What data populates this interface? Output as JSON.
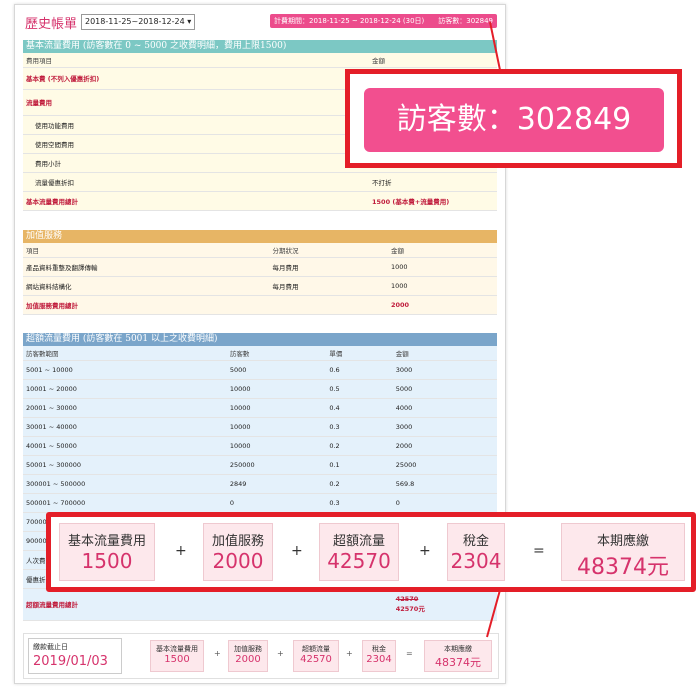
{
  "header": {
    "title": "歷史帳單",
    "period_select": "2018-11-25~2018-12-24",
    "summary_chip": "計費期間：2018-11-25 ~ 2018-12-24 (30日)　　訪客數：302849"
  },
  "basic": {
    "title": "基本流量費用 (訪客數在 0 ~ 5000 之收費明細，費用上限1500)",
    "col_item": "費用項目",
    "col_amount": "金額",
    "rows": [
      {
        "item": "基本費 (不列入優惠折扣)",
        "amount": ""
      },
      {
        "item": "流量費用",
        "amount": ""
      },
      {
        "item": "使用功能費用",
        "amount": ""
      },
      {
        "item": "使用空間費用",
        "amount": ""
      },
      {
        "item": "費用小計",
        "amount": ""
      },
      {
        "item": "流量優惠折扣",
        "amount": "不打折"
      },
      {
        "item": "基本流量費用總計",
        "amount": "1500 (基本費+流量費用)"
      }
    ]
  },
  "vas": {
    "title": "加值服務",
    "col_item": "項目",
    "col_period": "分期狀況",
    "col_amount": "金額",
    "rows": [
      {
        "item": "產品資料重整及翻譯傳輸",
        "period": "每月費用",
        "amount": "1000"
      },
      {
        "item": "網站資料結構化",
        "period": "每月費用",
        "amount": "1000"
      }
    ],
    "total_label": "加值服務費用總計",
    "total_amount": "2000"
  },
  "over": {
    "title": "超額流量費用 (訪客數在 5001 以上之收費明細)",
    "cols": [
      "訪客數範圍",
      "訪客數",
      "單價",
      "金額"
    ],
    "rows": [
      [
        "5001 ~ 10000",
        "5000",
        "0.6",
        "3000"
      ],
      [
        "10001 ~ 20000",
        "10000",
        "0.5",
        "5000"
      ],
      [
        "20001 ~ 30000",
        "10000",
        "0.4",
        "4000"
      ],
      [
        "30001 ~ 40000",
        "10000",
        "0.3",
        "3000"
      ],
      [
        "40001 ~ 50000",
        "10000",
        "0.2",
        "2000"
      ],
      [
        "50001 ~ 300000",
        "250000",
        "0.1",
        "25000"
      ],
      [
        "300001 ~ 500000",
        "2849",
        "0.2",
        "569.8"
      ],
      [
        "500001 ~ 700000",
        "0",
        "0.3",
        "0"
      ],
      [
        "70000",
        "",
        "",
        ""
      ],
      [
        "90000",
        "",
        "",
        ""
      ],
      [
        "人次費",
        "",
        "",
        ""
      ],
      [
        "優惠折",
        "",
        "",
        ""
      ]
    ],
    "total_label": "超額流量費用總計",
    "total_struck": "42570",
    "total_amount": "42570元"
  },
  "footer": {
    "due_label": "繳款截止日",
    "due_date": "2019/01/03",
    "items": [
      {
        "label": "基本流量費用",
        "value": "1500"
      },
      {
        "label": "加值服務",
        "value": "2000"
      },
      {
        "label": "超額流量",
        "value": "42570"
      },
      {
        "label": "稅金",
        "value": "2304"
      },
      {
        "label": "本期應繳",
        "value": "48374元"
      }
    ],
    "ops": [
      "+",
      "+",
      "+",
      "="
    ]
  },
  "callout_visitors": "訪客數：302849",
  "callout_summary": {
    "items": [
      {
        "label": "基本流量費用",
        "value": "1500"
      },
      {
        "label": "加值服務",
        "value": "2000"
      },
      {
        "label": "超額流量",
        "value": "42570"
      },
      {
        "label": "稅金",
        "value": "2304"
      },
      {
        "label": "本期應繳",
        "value": "48374元"
      }
    ],
    "ops": [
      "+",
      "+",
      "+",
      "="
    ]
  },
  "colors": {
    "accent": "#ec4c8c",
    "callout_border": "#e41e28",
    "basic": "#7cc8c4",
    "vas": "#e7b565",
    "over": "#7aa5ca"
  }
}
